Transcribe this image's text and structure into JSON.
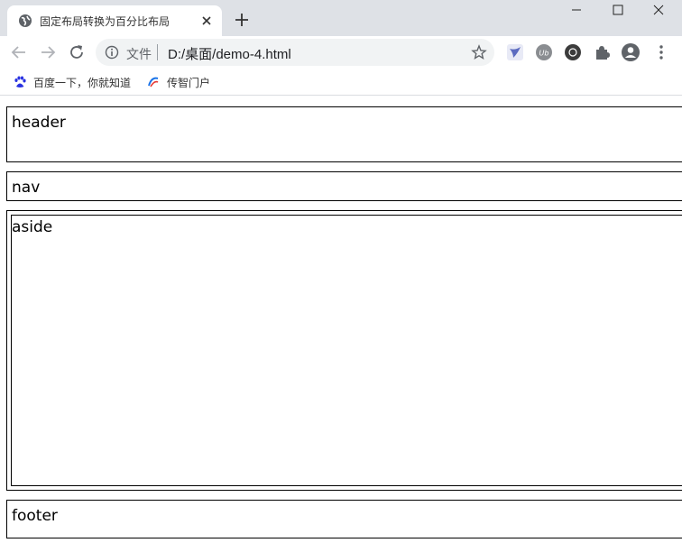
{
  "browser": {
    "tab_title": "固定布局转换为百分比布局",
    "file_label": "文件",
    "url": "D:/桌面/demo-4.html",
    "bookmarks": [
      {
        "label": "百度一下，你就知道"
      },
      {
        "label": "传智门户"
      }
    ]
  },
  "page": {
    "header": "header",
    "nav": "nav",
    "aside": "aside",
    "footer": "footer"
  },
  "colors": {
    "titlebar": "#dee1e6",
    "omnibox": "#f1f3f4",
    "border": "#000000"
  }
}
